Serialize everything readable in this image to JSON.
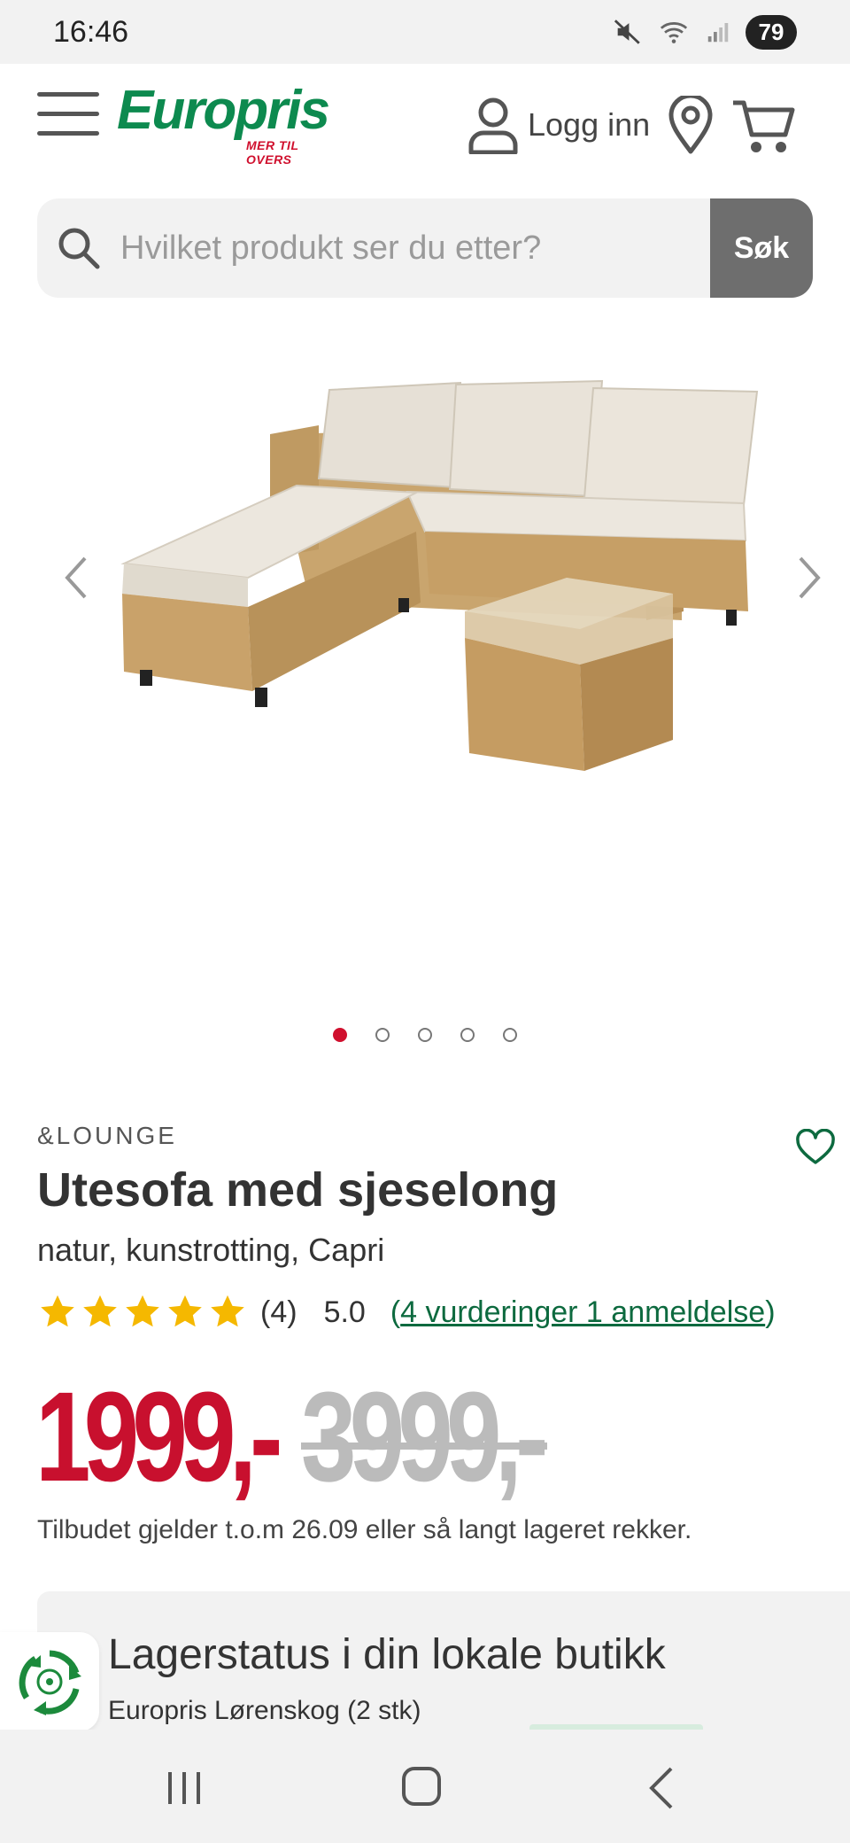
{
  "status_bar": {
    "time": "16:46",
    "battery": "79",
    "icons": [
      "mute-icon",
      "wifi-icon",
      "signal-icon"
    ]
  },
  "header": {
    "logo_text": "Europris",
    "logo_tagline": "MER TIL OVERS",
    "login_label": "Logg inn",
    "icons": [
      "menu-icon",
      "user-icon",
      "location-icon",
      "cart-icon"
    ]
  },
  "search": {
    "placeholder": "Hvilket produkt ser du etter?",
    "value": "",
    "button_label": "Søk"
  },
  "carousel": {
    "image_count": 5,
    "active_index": 0
  },
  "product": {
    "brand": "&LOUNGE",
    "title": "Utesofa med sjeselong",
    "subtitle": "natur, kunstrotting, Capri",
    "stars": 5,
    "rating_count": "(4)",
    "rating_score": "5.0",
    "reviews_link_open": "(",
    "reviews_link_text": "4 vurderinger 1 anmeldelse",
    "reviews_link_close": ")",
    "price": "1999,-",
    "old_price": "3999,-",
    "offer_note": "Tilbudet gjelder t.o.m 26.09 eller så langt lageret rekker."
  },
  "stock": {
    "title": "Lagerstatus i din lokale butikk",
    "store_line": "Europris Lørenskog (2 stk)"
  },
  "colors": {
    "brand_green": "#0d8a4f",
    "price_red": "#c8102e",
    "link_green": "#0d6a3f",
    "star_yellow": "#f5b800"
  }
}
